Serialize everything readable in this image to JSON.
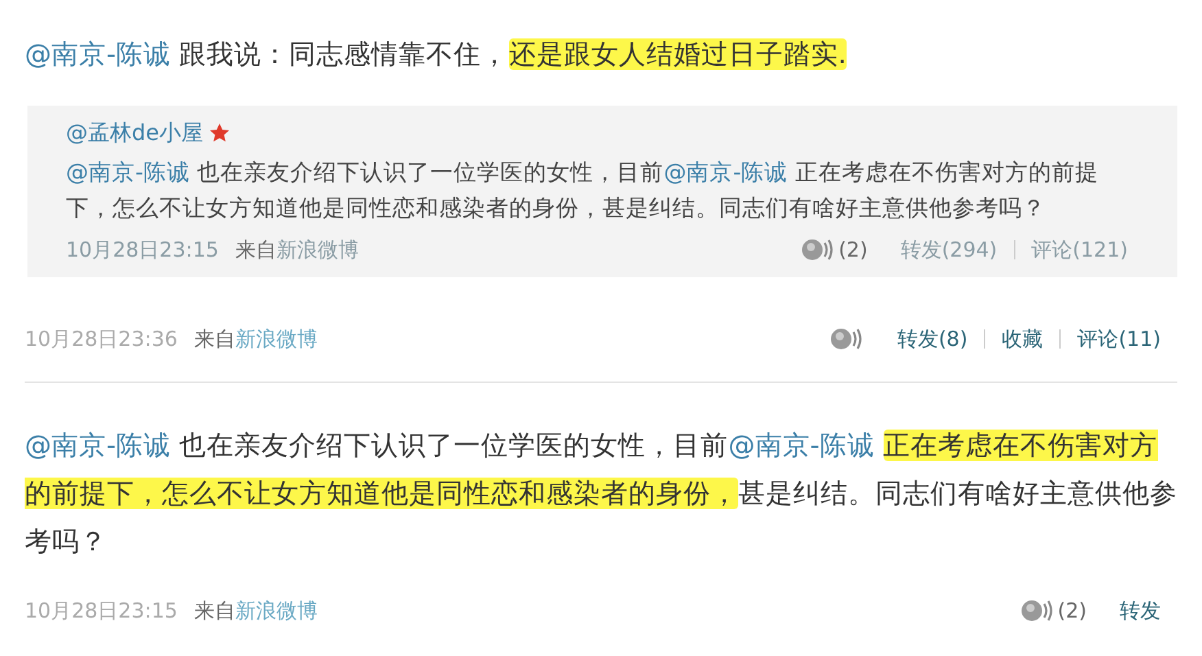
{
  "posts": [
    {
      "text": [
        {
          "kind": "mention",
          "text": "@南京-陈诚",
          "highlight": false
        },
        {
          "kind": "text",
          "text": " 跟我说：同志感情靠不住，",
          "highlight": false
        },
        {
          "kind": "text",
          "text": "还是跟女人结婚过日子踏实.",
          "highlight": true
        }
      ],
      "quote": {
        "author": "@孟林de小屋",
        "text": [
          {
            "kind": "mention",
            "text": "@南京-陈诚"
          },
          {
            "kind": "text",
            "text": " 也在亲友介绍下认识了一位学医的女性，目前"
          },
          {
            "kind": "mention",
            "text": "@南京-陈诚"
          },
          {
            "kind": "text",
            "text": " 正在考虑在不伤害对方的前提下，怎么不让女方知道他是同性恋和感染者的身份，甚是纠结。同志们有啥好主意供他参考吗？"
          }
        ],
        "meta": {
          "time": "10月28日23:15",
          "source_prefix": "来自",
          "source": "新浪微博",
          "actions": [
            {
              "kind": "voice",
              "label": "(2)"
            },
            {
              "kind": "link",
              "label": "转发(294)"
            },
            {
              "kind": "link",
              "label": "评论(121)"
            }
          ]
        }
      },
      "meta": {
        "time": "10月28日23:36",
        "source_prefix": "来自",
        "source": "新浪微博",
        "actions": [
          {
            "kind": "voice"
          },
          {
            "kind": "link",
            "label": "转发(8)"
          },
          {
            "kind": "link",
            "label": "收藏"
          },
          {
            "kind": "link",
            "label": "评论(11)"
          }
        ]
      }
    },
    {
      "text": [
        {
          "kind": "mention",
          "text": "@南京-陈诚",
          "highlight": false
        },
        {
          "kind": "text",
          "text": " 也在亲友介绍下认识了一位学医的女性，目前",
          "highlight": false
        },
        {
          "kind": "mention",
          "text": "@南京-陈诚 ",
          "highlight": false
        },
        {
          "kind": "text",
          "text": "正在考虑在不伤害对方的前提下，怎么不让女方知道他是同性恋和感染者的身份，",
          "highlight": true
        },
        {
          "kind": "text",
          "text": "甚是纠结。同志们有啥好主意供他参考吗？",
          "highlight": false
        }
      ],
      "meta": {
        "time": "10月28日23:15",
        "source_prefix": "来自",
        "source": "新浪微博",
        "actions": [
          {
            "kind": "voice",
            "label": "(2)"
          },
          {
            "kind": "link",
            "label": "转发"
          }
        ]
      }
    }
  ]
}
